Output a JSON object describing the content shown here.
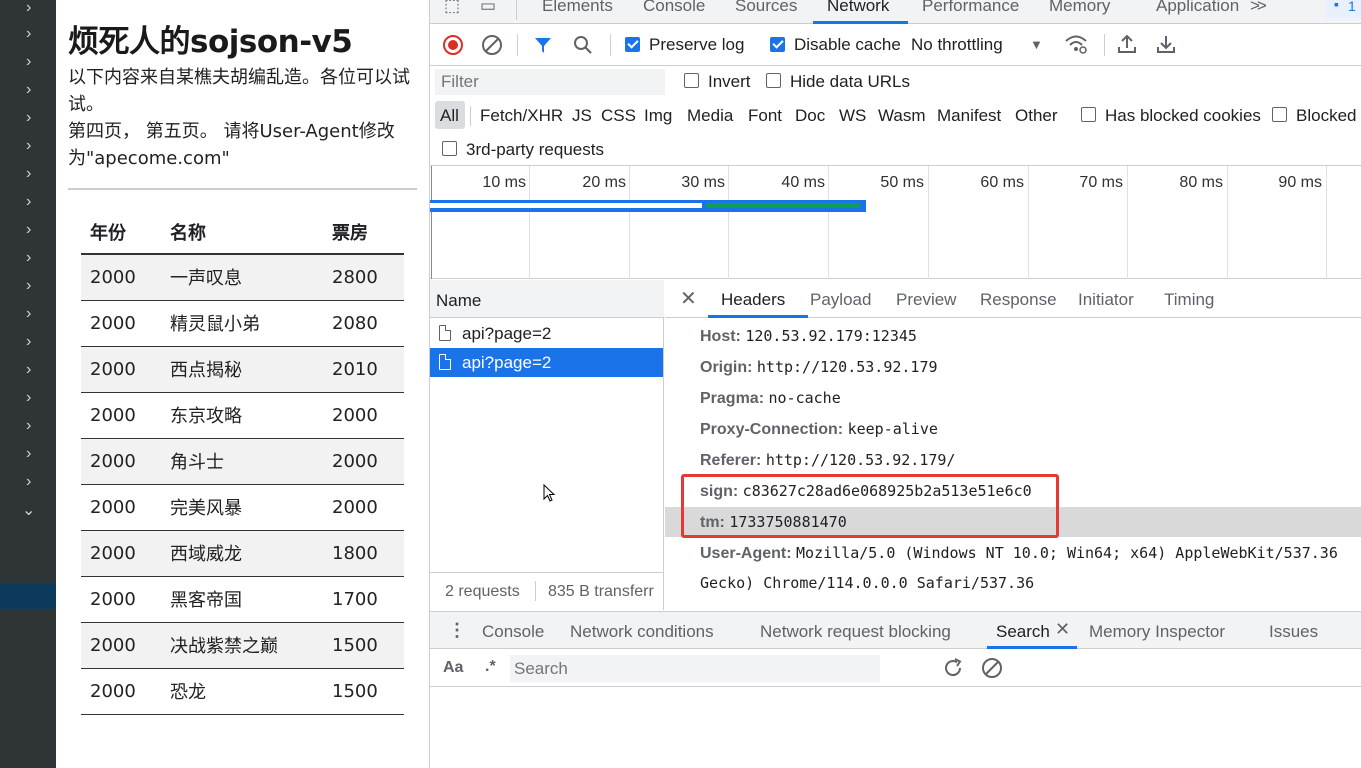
{
  "page": {
    "title": "烦死人的sojson-v5",
    "desc_line1": "以下内容来自某樵夫胡编乱造。各位可以试试。",
    "desc_line2": "第四页， 第五页。 请将User-Agent修改为\"apecome.com\"",
    "table": {
      "headers": [
        "年份",
        "名称",
        "票房"
      ],
      "rows": [
        [
          "2000",
          "一声叹息",
          "2800"
        ],
        [
          "2000",
          "精灵鼠小弟",
          "2080"
        ],
        [
          "2000",
          "西点揭秘",
          "2010"
        ],
        [
          "2000",
          "东京攻略",
          "2000"
        ],
        [
          "2000",
          "角斗士",
          "2000"
        ],
        [
          "2000",
          "完美风暴",
          "2000"
        ],
        [
          "2000",
          "西域威龙",
          "1800"
        ],
        [
          "2000",
          "黑客帝国",
          "1700"
        ],
        [
          "2000",
          "决战紫禁之巅",
          "1500"
        ],
        [
          "2000",
          "恐龙",
          "1500"
        ]
      ]
    }
  },
  "devtools": {
    "main_tabs": [
      "Elements",
      "Console",
      "Sources",
      "Network",
      "Performance",
      "Memory",
      "Application"
    ],
    "active_tab": "Network",
    "toolbar": {
      "preserve_log": "Preserve log",
      "disable_cache": "Disable cache",
      "throttling": "No throttling"
    },
    "filter": {
      "placeholder": "Filter",
      "invert": "Invert",
      "hide_data_urls": "Hide data URLs"
    },
    "types": [
      "All",
      "Fetch/XHR",
      "JS",
      "CSS",
      "Img",
      "Media",
      "Font",
      "Doc",
      "WS",
      "Wasm",
      "Manifest",
      "Other"
    ],
    "has_blocked_cookies": "Has blocked cookies",
    "blocked": "Blocked I",
    "third_party": "3rd-party requests",
    "timeline_ticks": [
      "10 ms",
      "20 ms",
      "30 ms",
      "40 ms",
      "50 ms",
      "60 ms",
      "70 ms",
      "80 ms",
      "90 ms"
    ],
    "requests": {
      "column": "Name",
      "items": [
        "api?page=2",
        "api?page=2"
      ],
      "footer_count": "2 requests",
      "footer_transfer": "835 B transferr"
    },
    "detail_tabs": [
      "Headers",
      "Payload",
      "Preview",
      "Response",
      "Initiator",
      "Timing"
    ],
    "headers": [
      {
        "k": "Host:",
        "v": "120.53.92.179:12345"
      },
      {
        "k": "Origin:",
        "v": "http://120.53.92.179"
      },
      {
        "k": "Pragma:",
        "v": "no-cache"
      },
      {
        "k": "Proxy-Connection:",
        "v": "keep-alive"
      },
      {
        "k": "Referer:",
        "v": "http://120.53.92.179/"
      },
      {
        "k": "sign:",
        "v": "c83627c28ad6e068925b2a513e51e6c0"
      },
      {
        "k": "tm:",
        "v": "1733750881470"
      },
      {
        "k": "User-Agent:",
        "v": "Mozilla/5.0 (Windows NT 10.0; Win64; x64) AppleWebKit/537.36"
      }
    ],
    "ua_continued": "Gecko) Chrome/114.0.0.0 Safari/537.36",
    "drawer_tabs": [
      "Console",
      "Network conditions",
      "Network request blocking",
      "Search",
      "Memory Inspector",
      "Issues"
    ],
    "search": {
      "aa": "Aa",
      "regex": ".*",
      "placeholder": "Search"
    },
    "badge_count": "1"
  }
}
